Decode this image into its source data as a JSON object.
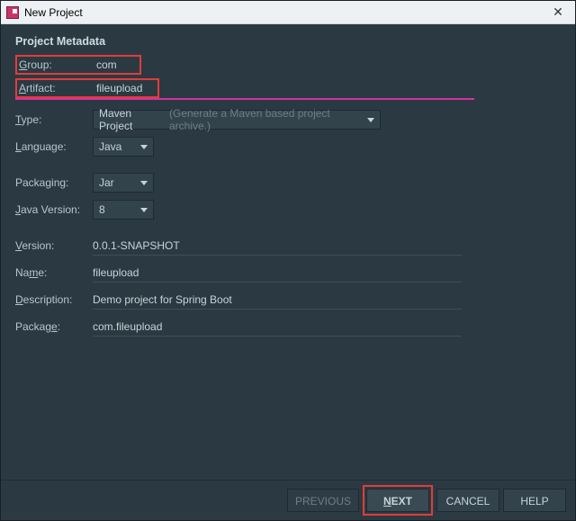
{
  "window": {
    "title": "New Project"
  },
  "section_title": "Project Metadata",
  "labels": {
    "group": "Group:",
    "artifact": "Artifact:",
    "type": "Type:",
    "language": "Language:",
    "packaging": "Packaging:",
    "java_version": "Java Version:",
    "version": "Version:",
    "name": "Name:",
    "description": "Description:",
    "package": "Package:"
  },
  "values": {
    "group": "com",
    "artifact": "fileupload",
    "type": "Maven Project",
    "type_hint": "(Generate a Maven based project archive.)",
    "language": "Java",
    "packaging": "Jar",
    "java_version": "8",
    "version": "0.0.1-SNAPSHOT",
    "name": "fileupload",
    "description": "Demo project for Spring Boot",
    "package": "com.fileupload"
  },
  "buttons": {
    "previous": "PREVIOUS",
    "next": "NEXT",
    "cancel": "CANCEL",
    "help": "HELP"
  }
}
